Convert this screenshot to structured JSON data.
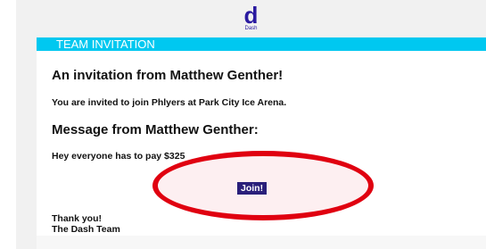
{
  "brand": {
    "logo_mark": "d",
    "logo_text": "Dash"
  },
  "banner": {
    "title": "TEAM INVITATION"
  },
  "email": {
    "heading": "An invitation from Matthew Genther!",
    "invite_text": "You are invited to join Phlyers at Park City Ice Arena.",
    "message_heading": "Message from Matthew Genther:",
    "message_body": "Hey everyone has to pay $325",
    "join_label": "Join!",
    "thanks_line1": "Thank you!",
    "thanks_line2": "The Dash Team"
  },
  "colors": {
    "brand": "#2a1aa0",
    "banner": "#00c8f0",
    "button": "#2a1f7a",
    "highlight": "#e00010"
  }
}
